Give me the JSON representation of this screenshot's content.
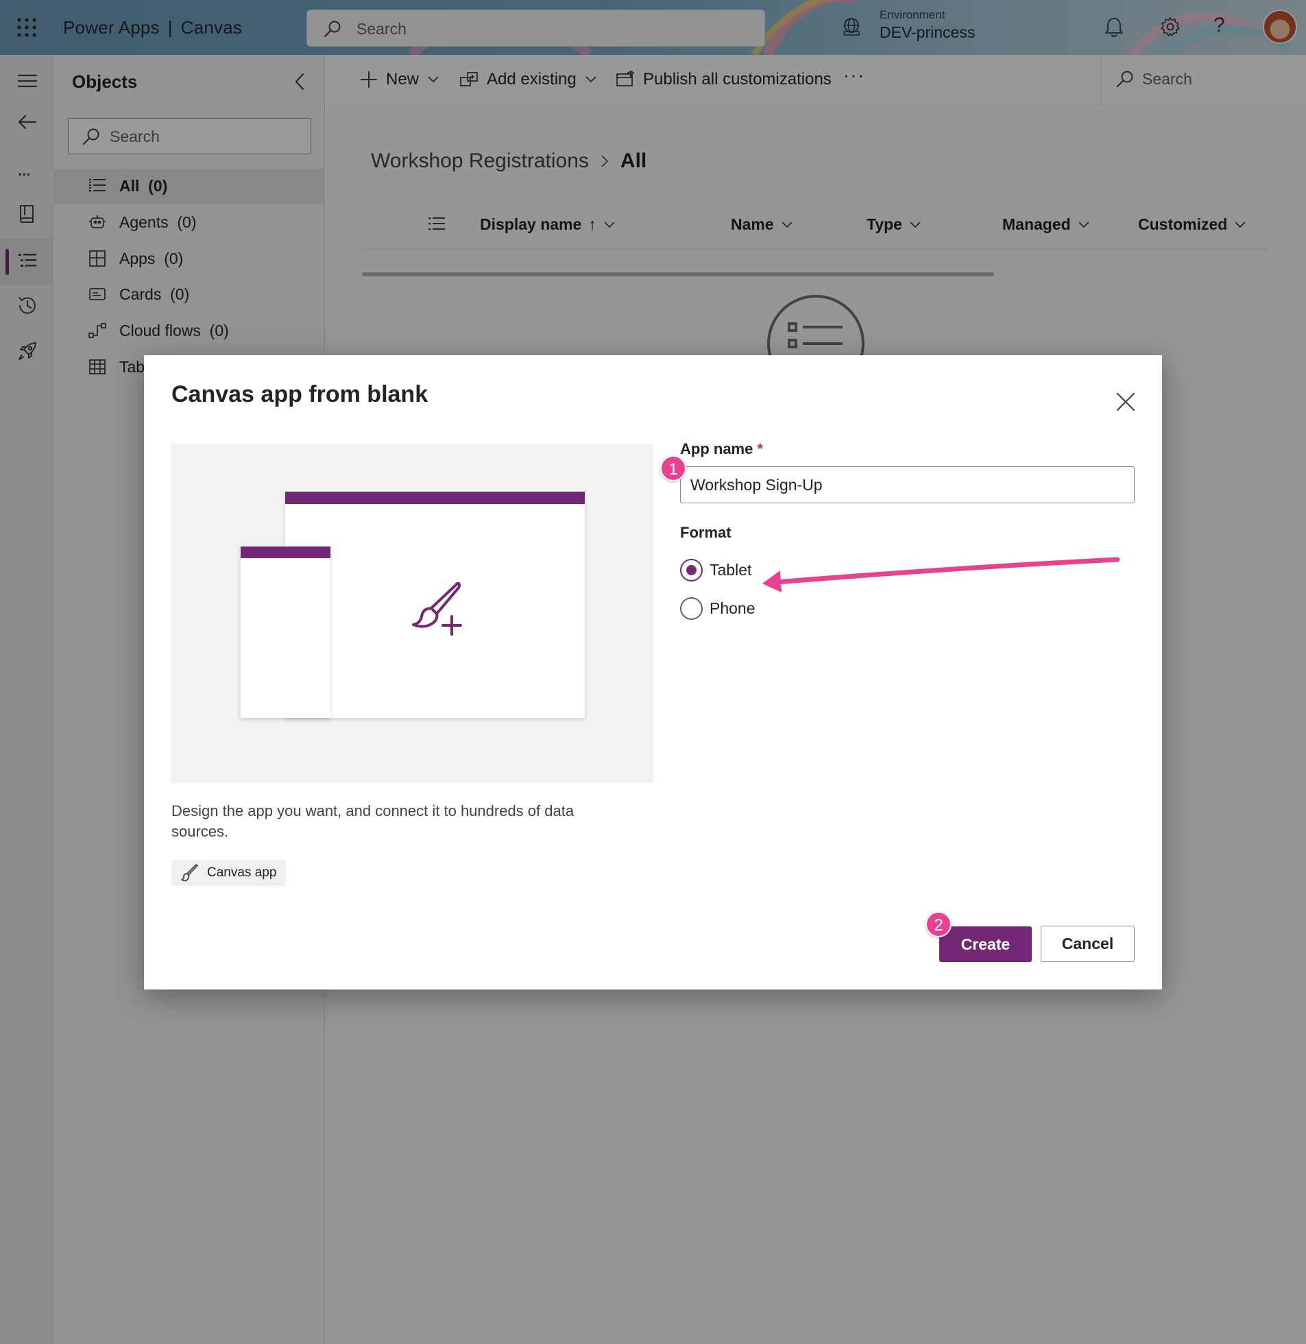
{
  "header": {
    "app_name": "Power Apps",
    "separator": "|",
    "context": "Canvas",
    "search_placeholder": "Search",
    "environment_label": "Environment",
    "environment_value": "DEV-princess",
    "help_glyph": "?"
  },
  "left_rail": {
    "items": [
      "menu-icon",
      "back-icon",
      "more-icon",
      "book-icon",
      "objects-icon",
      "history-icon",
      "deploy-icon"
    ],
    "active": "objects-icon",
    "more_glyph": "..."
  },
  "objects_panel": {
    "title": "Objects",
    "search_placeholder": "Search",
    "items": [
      {
        "label": "All",
        "count": "(0)",
        "icon": "list-icon",
        "selected": true
      },
      {
        "label": "Agents",
        "count": "(0)",
        "icon": "bot-icon"
      },
      {
        "label": "Apps",
        "count": "(0)",
        "icon": "apps-icon"
      },
      {
        "label": "Cards",
        "count": "(0)",
        "icon": "card-icon"
      },
      {
        "label": "Cloud flows",
        "count": "(0)",
        "icon": "flow-icon"
      },
      {
        "label": "Tab",
        "count": "",
        "icon": "table-icon"
      }
    ]
  },
  "command_bar": {
    "new_label": "New",
    "add_existing_label": "Add existing",
    "publish_label": "Publish all customizations",
    "more_glyph": "···",
    "search_placeholder": "Search"
  },
  "breadcrumb": {
    "parent": "Workshop Registrations",
    "separator": ">",
    "current": "All"
  },
  "grid": {
    "columns": [
      "Display name",
      "Name",
      "Type",
      "Managed",
      "Customized"
    ],
    "sort_glyph": "↑"
  },
  "dialog": {
    "title": "Canvas app from blank",
    "description": "Design the app you want, and connect it to hundreds of data sources.",
    "tag_label": "Canvas app",
    "app_name_label": "App name",
    "required_mark": "*",
    "app_name_value": "Workshop Sign-Up",
    "format_label": "Format",
    "format_options": [
      {
        "label": "Tablet",
        "selected": true
      },
      {
        "label": "Phone",
        "selected": false
      }
    ],
    "create_label": "Create",
    "cancel_label": "Cancel",
    "annotations": [
      "1",
      "2"
    ]
  },
  "colors": {
    "brand_purple": "#742774",
    "annotation_pink": "#e8418f",
    "required_red": "#c4314b"
  }
}
